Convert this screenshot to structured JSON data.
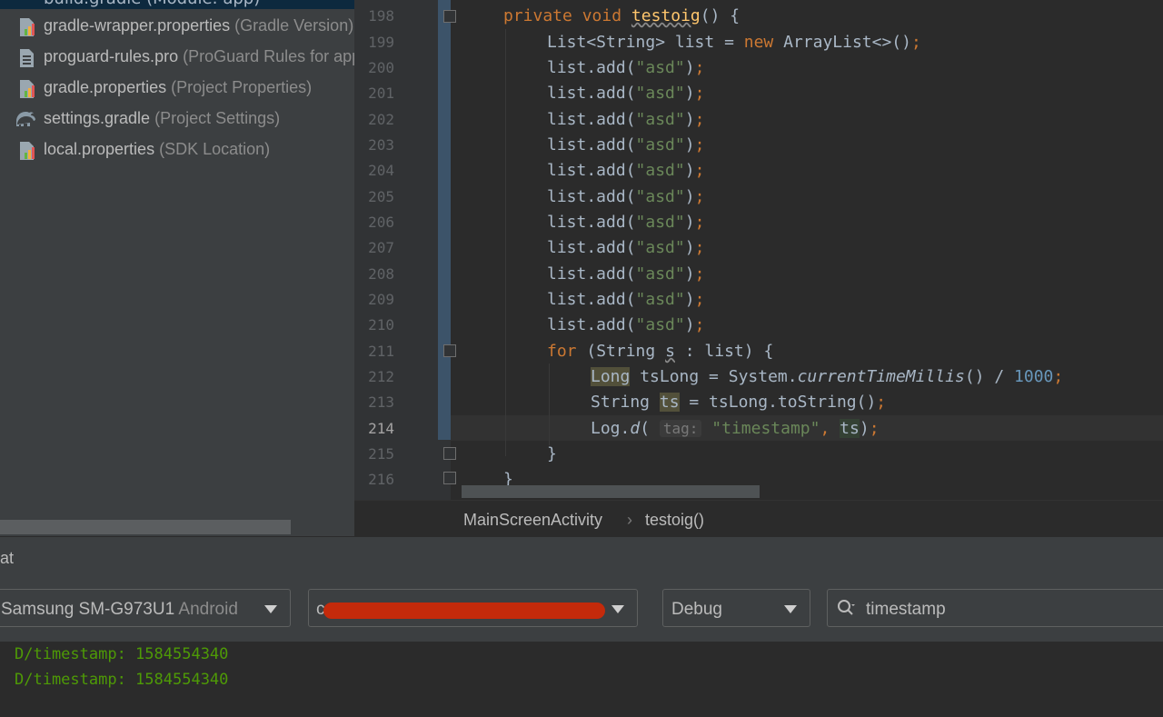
{
  "project_tree": {
    "selected_item": "build.gradle (Module: app)",
    "items": [
      {
        "name": "gradle-wrapper.properties",
        "detail": "(Gradle Version)",
        "icon": "properties-file-icon"
      },
      {
        "name": "proguard-rules.pro",
        "detail": "(ProGuard Rules for app)",
        "icon": "text-file-icon"
      },
      {
        "name": "gradle.properties",
        "detail": "(Project Properties)",
        "icon": "properties-file-icon"
      },
      {
        "name": "settings.gradle",
        "detail": "(Project Settings)",
        "icon": "gradle-elephant-icon"
      },
      {
        "name": "local.properties",
        "detail": "(SDK Location)",
        "icon": "properties-file-icon"
      }
    ]
  },
  "editor": {
    "current_line": "214",
    "line_numbers": [
      "198",
      "199",
      "200",
      "201",
      "202",
      "203",
      "204",
      "205",
      "206",
      "207",
      "208",
      "209",
      "210",
      "211",
      "212",
      "213",
      "214",
      "215",
      "216"
    ],
    "code": {
      "l198": {
        "kw1": "private",
        "kw2": "void",
        "fn": "testoig",
        "rest": "() {"
      },
      "l199": {
        "a": "List<String> list = ",
        "kw": "new",
        "b": " ArrayList<>()",
        "semi": ";"
      },
      "add_call": {
        "a": "list.add(",
        "str": "\"asd\"",
        "b": ")",
        "semi": ";"
      },
      "l211": {
        "kw": "for",
        "a": " (String ",
        "var": "s",
        "b": " : list) {"
      },
      "l212": {
        "type": "Long",
        "a": " tsLong = System.",
        "method": "currentTimeMillis",
        "b": "() / ",
        "num": "1000",
        "semi": ";"
      },
      "l213": {
        "a": "String ",
        "var": "ts",
        "b": " = tsLong.toString()",
        "semi": ";"
      },
      "l214": {
        "a": "Log.",
        "method": "d",
        "b": "( ",
        "hint": "tag:",
        "str": "\"timestamp\"",
        "c": ", ",
        "var": "ts",
        "d": ")",
        "semi": ";"
      },
      "l215": "}",
      "l216": "}"
    }
  },
  "breadcrumb": {
    "class_name": "MainScreenActivity",
    "separator": "›",
    "method_name": "testoig()"
  },
  "logcat": {
    "title": "at",
    "device": {
      "name": "Samsung SM-G973U1",
      "os": "Android"
    },
    "process_prefix": "c",
    "log_level": "Debug",
    "search_value": "timestamp",
    "lines": [
      "D/timestamp: 1584554340",
      "D/timestamp: 1584554340"
    ]
  },
  "colors": {
    "keyword": "#cc7832",
    "string": "#6a8759",
    "function": "#ffc66d",
    "number": "#6897bb",
    "log_debug": "#4e9a06",
    "redaction": "#c42a0b"
  }
}
